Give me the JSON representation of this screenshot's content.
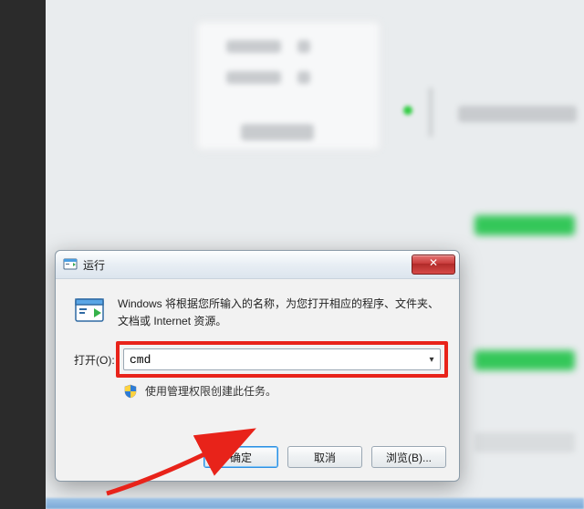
{
  "dialog": {
    "title": "运行",
    "description": "Windows 将根据您所输入的名称，为您打开相应的程序、文件夹、文档或 Internet 资源。",
    "open_label": "打开(O):",
    "open_value": "cmd",
    "admin_note": "使用管理权限创建此任务。",
    "buttons": {
      "ok": "确定",
      "cancel": "取消",
      "browse": "浏览(B)..."
    },
    "close_glyph": "✕"
  }
}
